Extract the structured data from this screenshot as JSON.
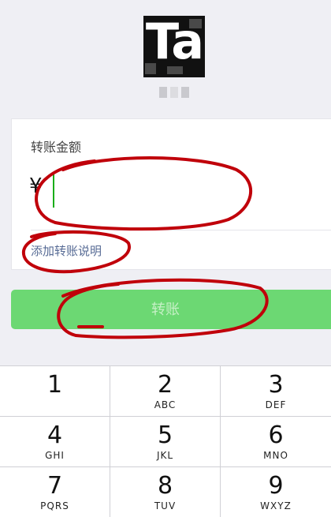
{
  "payee": {
    "avatar_text": "Ta"
  },
  "form": {
    "amount_label": "转账金额",
    "currency_symbol": "¥",
    "amount_value": "",
    "add_note_link": "添加转账说明",
    "transfer_button": "转账"
  },
  "keypad": {
    "keys": [
      {
        "num": "1",
        "letters": ""
      },
      {
        "num": "2",
        "letters": "ABC"
      },
      {
        "num": "3",
        "letters": "DEF"
      },
      {
        "num": "4",
        "letters": "GHI"
      },
      {
        "num": "5",
        "letters": "JKL"
      },
      {
        "num": "6",
        "letters": "MNO"
      },
      {
        "num": "7",
        "letters": "PQRS"
      },
      {
        "num": "8",
        "letters": "TUV"
      },
      {
        "num": "9",
        "letters": "WXYZ"
      }
    ]
  },
  "colors": {
    "accent_green": "#6cd873",
    "link_blue": "#576b95",
    "annotation_red": "#c0000a"
  }
}
